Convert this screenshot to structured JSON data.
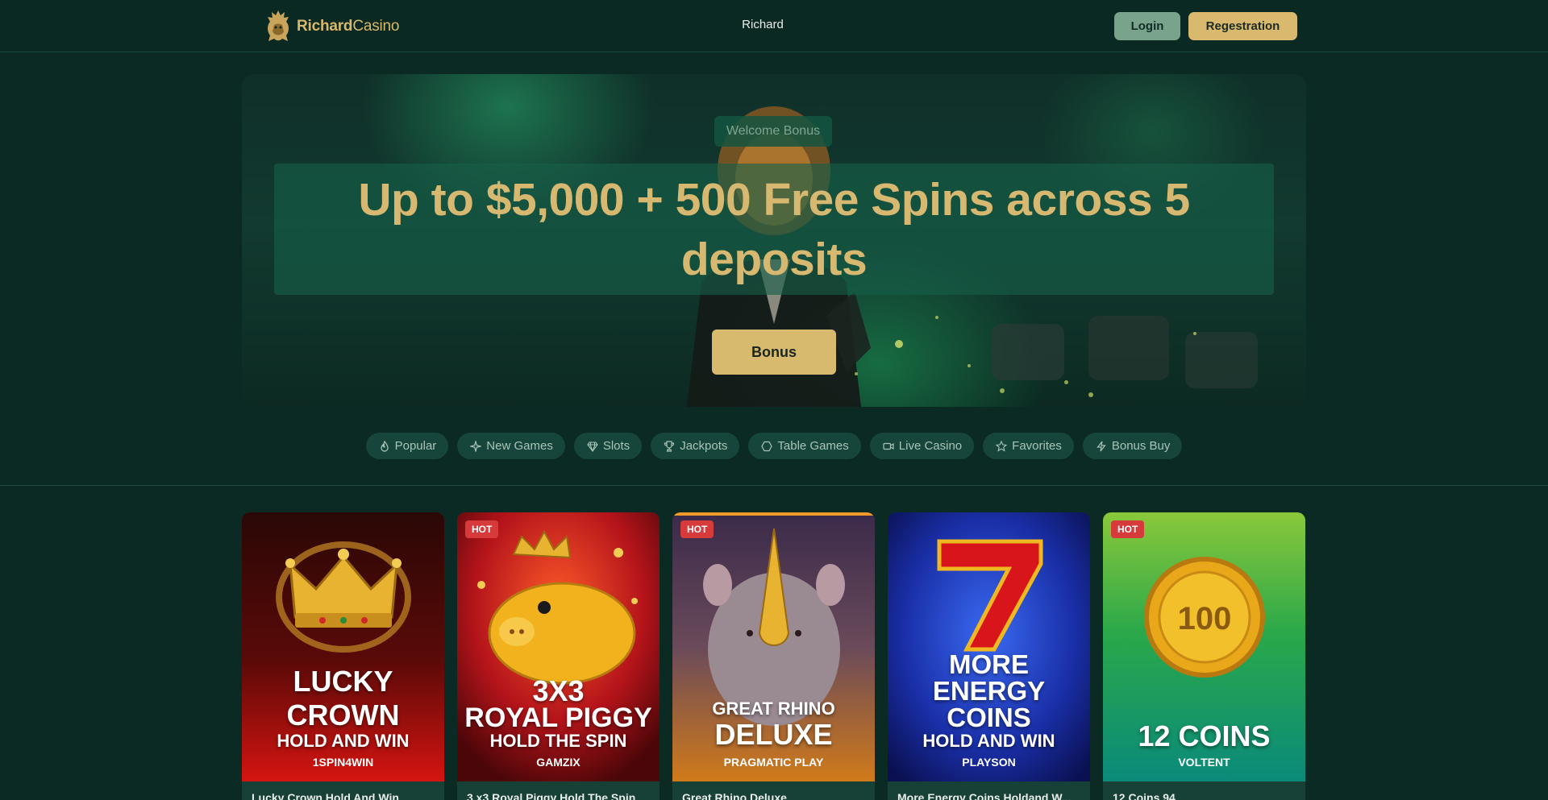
{
  "header": {
    "brand_bold": "Richard",
    "brand_light": "Casino",
    "nav_link": "Richard",
    "login_label": "Login",
    "registration_label": "Regestration"
  },
  "hero": {
    "badge": "Welcome Bonus",
    "headline": "Up to $5,000 + 500 Free Spins across 5 deposits",
    "cta_label": "Bonus"
  },
  "categories": [
    {
      "label": "Popular",
      "icon": "flame-icon"
    },
    {
      "label": "New Games",
      "icon": "sparkle-icon"
    },
    {
      "label": "Slots",
      "icon": "diamond-icon"
    },
    {
      "label": "Jackpots",
      "icon": "trophy-icon"
    },
    {
      "label": "Table Games",
      "icon": "hexagon-icon"
    },
    {
      "label": "Live Casino",
      "icon": "video-icon"
    },
    {
      "label": "Favorites",
      "icon": "star-icon"
    },
    {
      "label": "Bonus Buy",
      "icon": "lightning-icon"
    }
  ],
  "games": [
    {
      "name": "Lucky Crown Hold And Win",
      "art_line1": "LUCKY",
      "art_line2": "CROWN",
      "art_line3": "HOLD AND WIN",
      "provider": "1SPIN4WIN",
      "hot": "",
      "accent": "#c8121a"
    },
    {
      "name": "3 x3 Royal Piggy Hold The Spin",
      "art_line1": "3X3",
      "art_line2": "ROYAL PIGGY",
      "art_line3": "HOLD THE SPIN",
      "provider": "GAMZIX",
      "hot": "HOT",
      "accent": "#b5161c"
    },
    {
      "name": "Great Rhino Deluxe",
      "art_line1": "GREAT RHINO",
      "art_line2": "DELUXE",
      "art_line3": "",
      "provider": "PRAGMATIC PLAY",
      "hot": "HOT",
      "accent": "#c86a1a"
    },
    {
      "name": "More Energy Coins Holdand W...",
      "art_line1": "MORE",
      "art_line2": "ENERGY",
      "art_line3": "COINS",
      "art_line4": "HOLD AND WIN",
      "provider": "PLAYSON",
      "hot": "",
      "accent": "#1a2fa8"
    },
    {
      "name": "12 Coins 94",
      "art_line1": "12 COINS",
      "art_line2": "",
      "art_line3": "",
      "provider": "VOLTENT",
      "hot": "HOT",
      "accent": "#0e9a86"
    }
  ],
  "colors": {
    "background": "#0b2a24",
    "gold": "#d9b86a",
    "login": "#7aa38b",
    "pill": "#16463b",
    "hot_badge": "#d63a3a"
  }
}
